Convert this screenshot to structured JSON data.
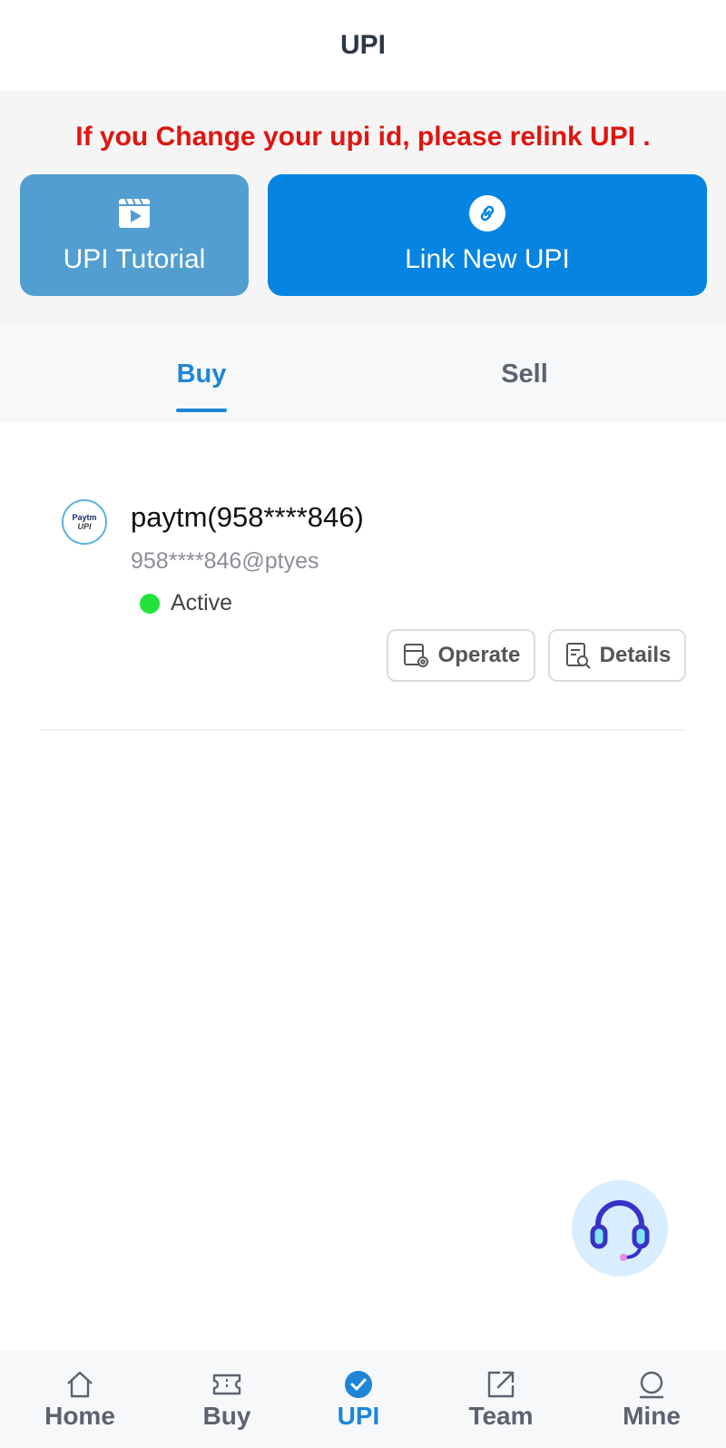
{
  "header": {
    "title": "UPI"
  },
  "notice": {
    "text": "If you Change your upi id, please relink UPI ."
  },
  "actions": {
    "tutorial_label": "UPI Tutorial",
    "link_label": "Link New UPI"
  },
  "tabs": [
    {
      "label": "Buy",
      "active": true
    },
    {
      "label": "Sell",
      "active": false
    }
  ],
  "upi_account": {
    "logo_text_top": "Paytm",
    "logo_text_bottom": "UPI",
    "title": "paytm(958****846)",
    "upi_id": "958****846@ptyes",
    "status": "Active",
    "status_color": "#22e33a",
    "operate_label": "Operate",
    "details_label": "Details"
  },
  "bottom_nav": [
    {
      "label": "Home",
      "icon": "home-icon"
    },
    {
      "label": "Buy",
      "icon": "ticket-icon"
    },
    {
      "label": "UPI",
      "icon": "check-circle-icon",
      "active": true
    },
    {
      "label": "Team",
      "icon": "share-icon"
    },
    {
      "label": "Mine",
      "icon": "user-icon"
    }
  ],
  "colors": {
    "accent": "#1e86d8",
    "notice": "#e0150f",
    "tutorial_button": "#539ed0",
    "link_button": "#0584e1"
  }
}
